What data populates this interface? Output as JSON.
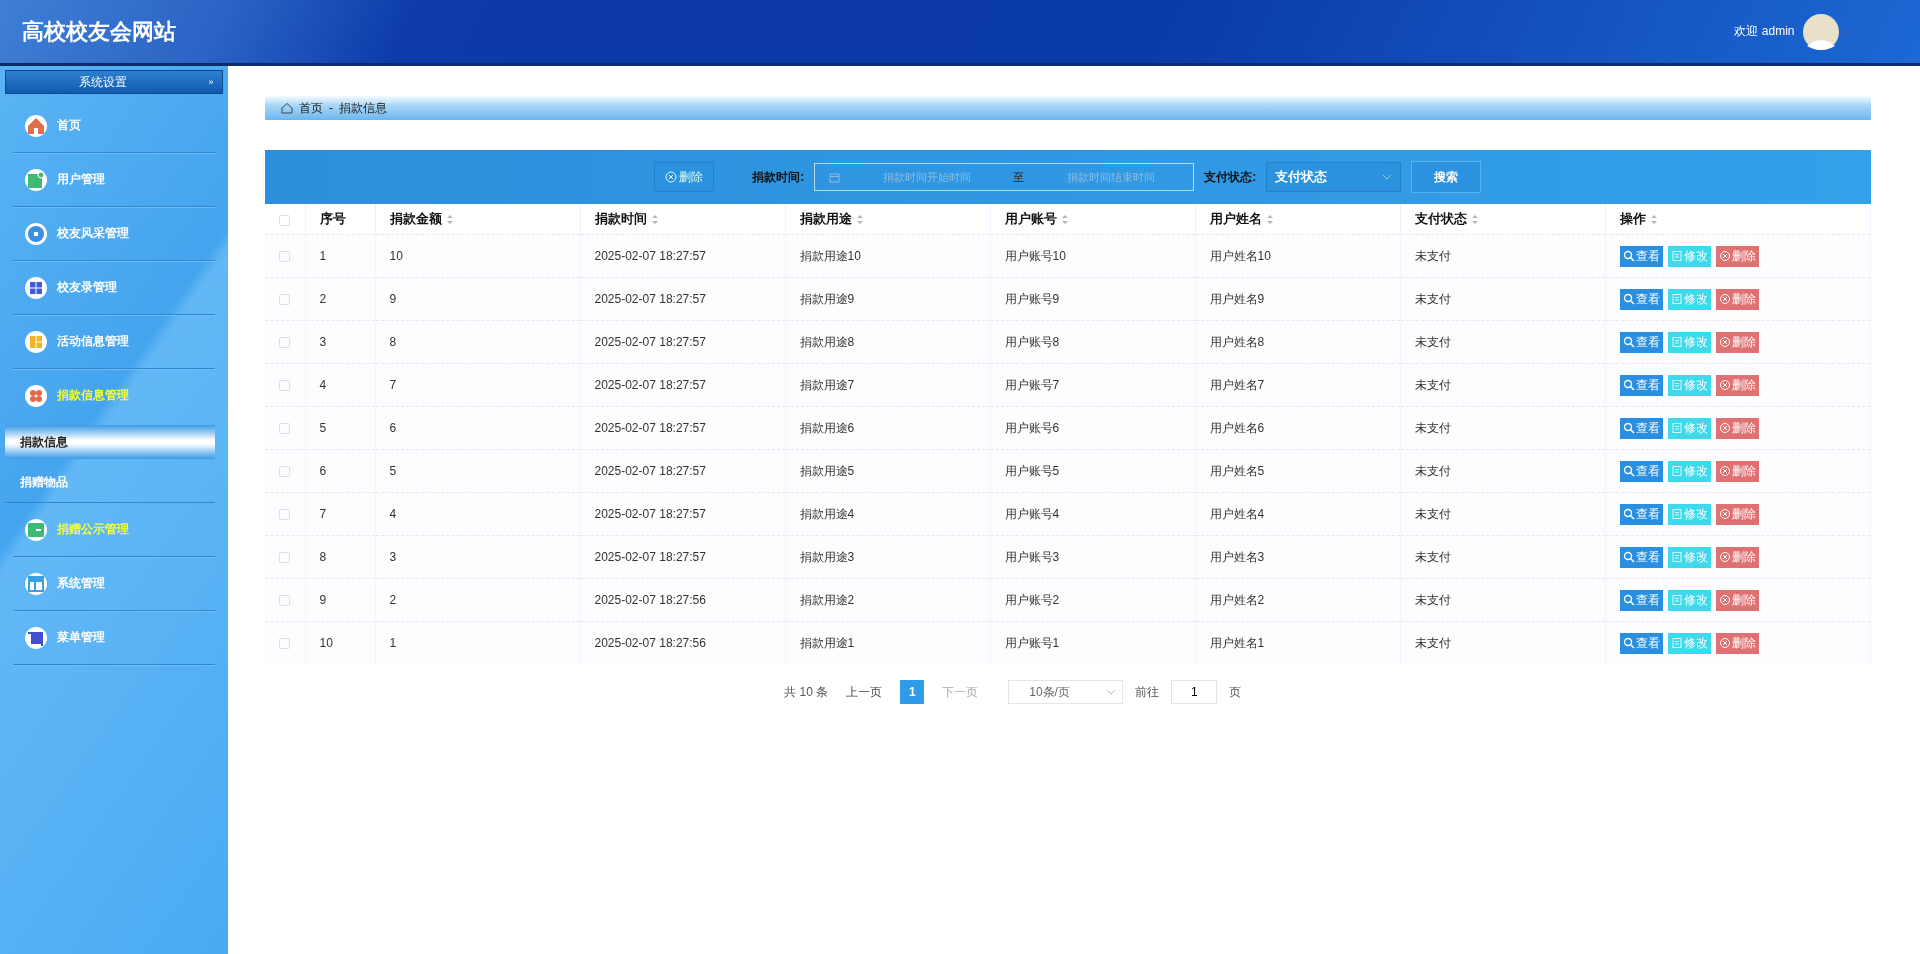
{
  "header": {
    "title": "高校校友会网站",
    "welcome": "欢迎 admin"
  },
  "sidebar": {
    "title": "系统设置",
    "toggle": "»",
    "items": [
      {
        "label": "首页",
        "color": "#e0704c",
        "highlighted": false
      },
      {
        "label": "用户管理",
        "color": "#3dbb74",
        "highlighted": false
      },
      {
        "label": "校友风采管理",
        "color": "#3a8fe0",
        "highlighted": false
      },
      {
        "label": "校友录管理",
        "color": "#3f5fd8",
        "highlighted": false
      },
      {
        "label": "活动信息管理",
        "color": "#f0b428",
        "highlighted": false
      },
      {
        "label": "捐款信息管理",
        "color": "#e0684a",
        "highlighted": true,
        "children": [
          {
            "label": "捐款信息",
            "selected": true
          },
          {
            "label": "捐赠物品",
            "selected": false
          }
        ]
      },
      {
        "label": "捐赠公示管理",
        "color": "#3dbb74",
        "highlighted": true
      },
      {
        "label": "系统管理",
        "color": "#3aa0e0",
        "highlighted": false
      },
      {
        "label": "菜单管理",
        "color": "#3f4fd0",
        "highlighted": false
      }
    ]
  },
  "breadcrumb": [
    "首页",
    "-",
    "捐款信息"
  ],
  "toolbar": {
    "delete": "删除",
    "date_label": "捐款时间:",
    "start_placeholder": "捐款时间开始时间",
    "separator": "至",
    "end_placeholder": "捐款时间结束时间",
    "status_label": "支付状态:",
    "status_placeholder": "支付状态",
    "search": "搜索"
  },
  "table": {
    "header_checked": false,
    "columns": [
      "序号",
      "捐款金额",
      "捐款时间",
      "捐款用途",
      "用户账号",
      "用户姓名",
      "支付状态",
      "操作"
    ],
    "rows": [
      {
        "checked": false,
        "cells": [
          "1",
          "10",
          "2025-02-07 18:27:57",
          "捐款用途10",
          "用户账号10",
          "用户姓名10",
          "未支付"
        ],
        "actions": [
          {
            "kind": "view",
            "label": "查看"
          },
          {
            "kind": "edit",
            "label": "修改"
          },
          {
            "kind": "delete",
            "label": "删除"
          }
        ]
      },
      {
        "checked": false,
        "cells": [
          "2",
          "9",
          "2025-02-07 18:27:57",
          "捐款用途9",
          "用户账号9",
          "用户姓名9",
          "未支付"
        ],
        "actions": [
          {
            "kind": "view",
            "label": "查看"
          },
          {
            "kind": "edit",
            "label": "修改"
          },
          {
            "kind": "delete",
            "label": "删除"
          }
        ]
      },
      {
        "checked": false,
        "cells": [
          "3",
          "8",
          "2025-02-07 18:27:57",
          "捐款用途8",
          "用户账号8",
          "用户姓名8",
          "未支付"
        ],
        "actions": [
          {
            "kind": "view",
            "label": "查看"
          },
          {
            "kind": "edit",
            "label": "修改"
          },
          {
            "kind": "delete",
            "label": "删除"
          }
        ]
      },
      {
        "checked": false,
        "cells": [
          "4",
          "7",
          "2025-02-07 18:27:57",
          "捐款用途7",
          "用户账号7",
          "用户姓名7",
          "未支付"
        ],
        "actions": [
          {
            "kind": "view",
            "label": "查看"
          },
          {
            "kind": "edit",
            "label": "修改"
          },
          {
            "kind": "delete",
            "label": "删除"
          }
        ]
      },
      {
        "checked": false,
        "cells": [
          "5",
          "6",
          "2025-02-07 18:27:57",
          "捐款用途6",
          "用户账号6",
          "用户姓名6",
          "未支付"
        ],
        "actions": [
          {
            "kind": "view",
            "label": "查看"
          },
          {
            "kind": "edit",
            "label": "修改"
          },
          {
            "kind": "delete",
            "label": "删除"
          }
        ]
      },
      {
        "checked": false,
        "cells": [
          "6",
          "5",
          "2025-02-07 18:27:57",
          "捐款用途5",
          "用户账号5",
          "用户姓名5",
          "未支付"
        ],
        "actions": [
          {
            "kind": "view",
            "label": "查看"
          },
          {
            "kind": "edit",
            "label": "修改"
          },
          {
            "kind": "delete",
            "label": "删除"
          }
        ]
      },
      {
        "checked": false,
        "cells": [
          "7",
          "4",
          "2025-02-07 18:27:57",
          "捐款用途4",
          "用户账号4",
          "用户姓名4",
          "未支付"
        ],
        "actions": [
          {
            "kind": "view",
            "label": "查看"
          },
          {
            "kind": "edit",
            "label": "修改"
          },
          {
            "kind": "delete",
            "label": "删除"
          }
        ]
      },
      {
        "checked": false,
        "cells": [
          "8",
          "3",
          "2025-02-07 18:27:57",
          "捐款用途3",
          "用户账号3",
          "用户姓名3",
          "未支付"
        ],
        "actions": [
          {
            "kind": "view",
            "label": "查看"
          },
          {
            "kind": "edit",
            "label": "修改"
          },
          {
            "kind": "delete",
            "label": "删除"
          }
        ]
      },
      {
        "checked": false,
        "cells": [
          "9",
          "2",
          "2025-02-07 18:27:56",
          "捐款用途2",
          "用户账号2",
          "用户姓名2",
          "未支付"
        ],
        "actions": [
          {
            "kind": "view",
            "label": "查看"
          },
          {
            "kind": "edit",
            "label": "修改"
          },
          {
            "kind": "delete",
            "label": "删除"
          }
        ]
      },
      {
        "checked": false,
        "cells": [
          "10",
          "1",
          "2025-02-07 18:27:56",
          "捐款用途1",
          "用户账号1",
          "用户姓名1",
          "未支付"
        ],
        "actions": [
          {
            "kind": "view",
            "label": "查看"
          },
          {
            "kind": "edit",
            "label": "修改"
          },
          {
            "kind": "delete",
            "label": "删除"
          }
        ]
      }
    ]
  },
  "pagination": {
    "total": "共 10 条",
    "prev": "上一页",
    "pages": [
      {
        "label": "1",
        "selected": true
      }
    ],
    "next": "下一页",
    "next_disabled": true,
    "page_size": "10条/页",
    "goto": "前往",
    "goto_value": "1",
    "page_unit": "页"
  }
}
